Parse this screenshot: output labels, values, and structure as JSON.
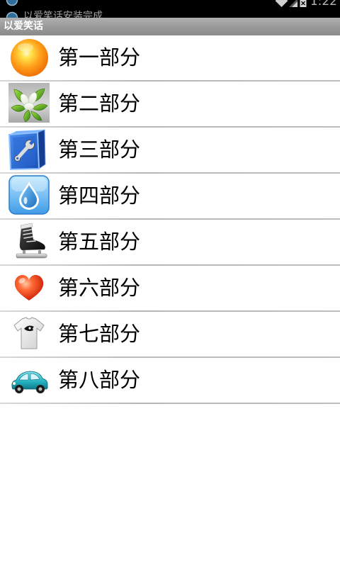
{
  "status_bar": {
    "ticker_text": "以爱笑话安装完成",
    "time": "1:22",
    "background": "#000000",
    "notification_icon": "app-notification-icon",
    "system_icons": [
      "wifi-icon",
      "signal-icon",
      "battery-icon"
    ]
  },
  "title_bar": {
    "title": "以爱笑话",
    "background": "#9c9c9c",
    "text_color": "#ffffff"
  },
  "list": {
    "background": "#ffffff",
    "text_color": "#000000",
    "divider_color": "#bdbdbd",
    "items": [
      {
        "label": "第一部分",
        "icon": "sun-ball-icon"
      },
      {
        "label": "第二部分",
        "icon": "leaves-flower-icon"
      },
      {
        "label": "第三部分",
        "icon": "wrench-box-icon"
      },
      {
        "label": "第四部分",
        "icon": "water-drop-icon"
      },
      {
        "label": "第五部分",
        "icon": "ice-skate-icon"
      },
      {
        "label": "第六部分",
        "icon": "heart-icon"
      },
      {
        "label": "第七部分",
        "icon": "t-shirt-icon"
      },
      {
        "label": "第八部分",
        "icon": "car-icon"
      }
    ]
  }
}
